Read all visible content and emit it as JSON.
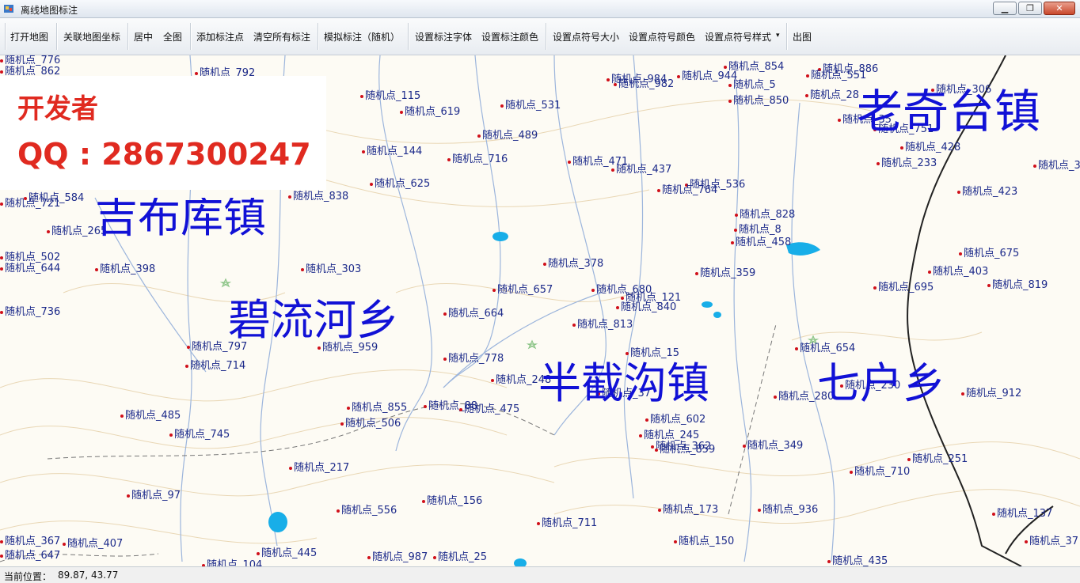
{
  "window": {
    "title": "离线地图标注",
    "controls": {
      "minimize": "▁",
      "maximize": "❐",
      "close": "✕"
    }
  },
  "toolbar": {
    "items": [
      "打开地图",
      "关联地图坐标",
      "居中",
      "全图",
      "添加标注点",
      "清空所有标注",
      "模拟标注（随机）",
      "设置标注字体",
      "设置标注颜色",
      "设置点符号大小",
      "设置点符号颜色",
      "设置点符号样式",
      "出图"
    ],
    "dropdown_arrow": "▾"
  },
  "developer": {
    "title": "开发者",
    "contact": "QQ : 2867300247"
  },
  "towns": [
    "老奇台镇",
    "吉布库镇",
    "碧流河乡",
    "半截沟镇",
    "七户乡"
  ],
  "markers": [
    "随机点_776",
    "随机点_862",
    "随机点_792",
    "随机点_115",
    "随机点_531",
    "随机点_619",
    "随机点_489",
    "随机点_144",
    "随机点_716",
    "随机点_625",
    "随机点_471",
    "随机点_437",
    "随机点_536",
    "随机点_764",
    "随机点_984",
    "随机点_982",
    "随机点_944",
    "随机点_854",
    "随机点_5",
    "随机点_850",
    "随机点_886",
    "随机点_551",
    "随机点_306",
    "随机点_28",
    "随机点_35",
    "随机点_751",
    "随机点_428",
    "随机点_233",
    "随机点_3",
    "随机点_423",
    "随机点_584",
    "随机点_838",
    "随机点_721",
    "随机点_265",
    "随机点_502",
    "随机点_644",
    "随机点_398",
    "随机点_303",
    "随机点_378",
    "随机点_828",
    "随机点_8",
    "随机点_458",
    "随机点_675",
    "随机点_403",
    "随机点_819",
    "随机点_359",
    "随机点_695",
    "随机点_657",
    "随机点_680",
    "随机点_121",
    "随机点_840",
    "随机点_736",
    "随机点_664",
    "随机点_813",
    "随机点_797",
    "随机点_959",
    "随机点_714",
    "随机点_778",
    "随机点_654",
    "随机点_15",
    "随机点_248",
    "随机点_37",
    "随机点_280",
    "随机点_230",
    "随机点_912",
    "随机点_485",
    "随机点_855",
    "随机点_506",
    "随机点_88",
    "随机点_475",
    "随机点_602",
    "随机点_745",
    "随机点_245",
    "随机点_362",
    "随机点_859",
    "随机点_349",
    "随机点_217",
    "随机点_251",
    "随机点_710",
    "随机点_97",
    "随机点_156",
    "随机点_556",
    "随机点_173",
    "随机点_936",
    "随机点_711",
    "随机点_367",
    "随机点_407",
    "随机点_647",
    "随机点_445",
    "随机点_987",
    "随机点_25",
    "随机点_150",
    "随机点_435",
    "随机点_104",
    "随机点_137",
    "随机点_37"
  ],
  "status": {
    "label": "当前位置：",
    "value": "89.87, 43.77"
  }
}
